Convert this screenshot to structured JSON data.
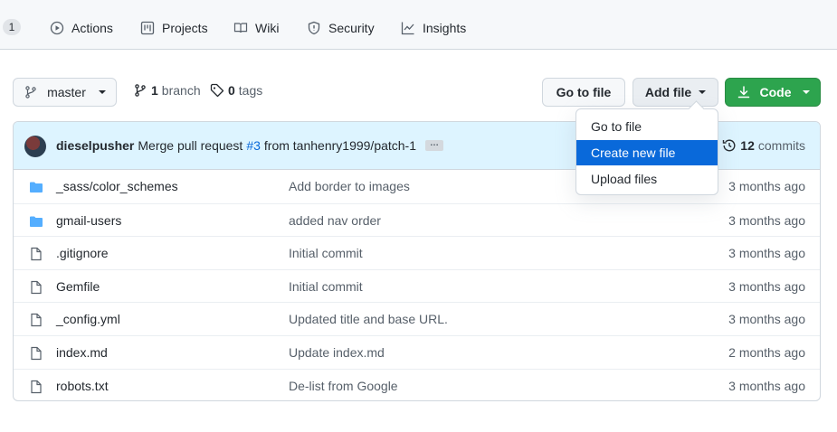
{
  "topnav": {
    "counter": "1",
    "tabs": [
      {
        "label": "Actions",
        "icon": "play-circle-icon"
      },
      {
        "label": "Projects",
        "icon": "project-board-icon"
      },
      {
        "label": "Wiki",
        "icon": "book-icon"
      },
      {
        "label": "Security",
        "icon": "shield-icon"
      },
      {
        "label": "Insights",
        "icon": "graph-icon"
      }
    ]
  },
  "toolbar": {
    "branch_label": "master",
    "branch_count": "1",
    "branch_word": "branch",
    "tag_count": "0",
    "tag_word": "tags",
    "go_to_file": "Go to file",
    "add_file": "Add file",
    "code": "Code"
  },
  "dropdown": {
    "items": [
      "Go to file",
      "Create new file",
      "Upload files"
    ],
    "active_index": 1
  },
  "commit": {
    "author": "dieselpusher",
    "message_prefix": "Merge pull request",
    "pr_link": "#3",
    "message_suffix": "from tanhenry1999/patch-1",
    "ellipsis": "…",
    "commit_count": "12",
    "commit_word": "commits"
  },
  "files": [
    {
      "type": "folder",
      "name": "_sass/color_schemes",
      "message": "Add border to images",
      "date": "3 months ago"
    },
    {
      "type": "folder",
      "name": "gmail-users",
      "message": "added nav order",
      "date": "3 months ago"
    },
    {
      "type": "file",
      "name": ".gitignore",
      "message": "Initial commit",
      "date": "3 months ago"
    },
    {
      "type": "file",
      "name": "Gemfile",
      "message": "Initial commit",
      "date": "3 months ago"
    },
    {
      "type": "file",
      "name": "_config.yml",
      "message": "Updated title and base URL.",
      "date": "3 months ago"
    },
    {
      "type": "file",
      "name": "index.md",
      "message": "Update index.md",
      "date": "2 months ago"
    },
    {
      "type": "file",
      "name": "robots.txt",
      "message": "De-list from Google",
      "date": "3 months ago"
    }
  ],
  "colors": {
    "accent": "#0969da",
    "green": "#2da44e",
    "folder": "#54aeff"
  }
}
